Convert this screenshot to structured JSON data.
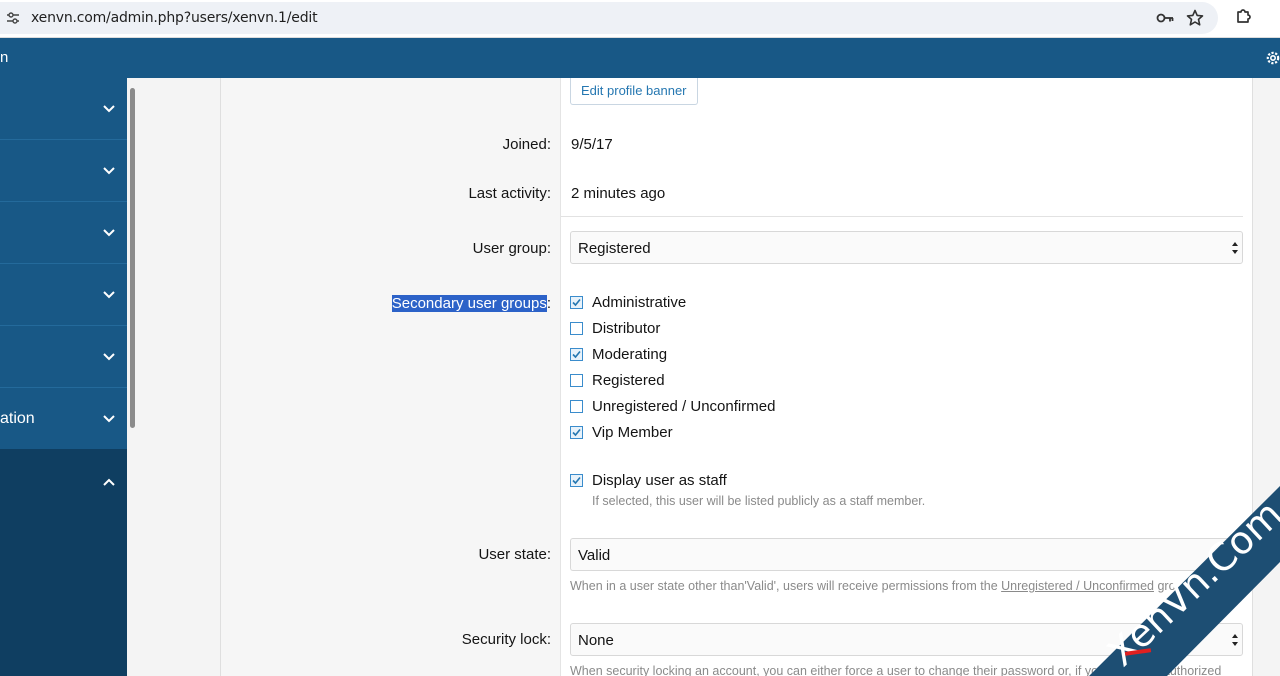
{
  "browser": {
    "url": "xenvn.com/admin.php?users/xenvn.1/edit"
  },
  "header": {
    "title_fragment": "n"
  },
  "sidebar": {
    "partial_label": "ation"
  },
  "form": {
    "edit_banner_label": "Edit profile banner",
    "joined": {
      "label": "Joined:",
      "value": "9/5/17"
    },
    "last_activity": {
      "label": "Last activity:",
      "value": "2 minutes ago"
    },
    "user_group": {
      "label": "User group:",
      "value": "Registered"
    },
    "secondary_groups": {
      "label_highlighted": "Secondary user groups",
      "label_suffix": ":",
      "options": [
        {
          "label": "Administrative",
          "checked": true
        },
        {
          "label": "Distributor",
          "checked": false
        },
        {
          "label": "Moderating",
          "checked": true
        },
        {
          "label": "Registered",
          "checked": false
        },
        {
          "label": "Unregistered / Unconfirmed",
          "checked": false
        },
        {
          "label": "Vip Member",
          "checked": true
        }
      ]
    },
    "display_staff": {
      "label": "Display user as staff",
      "checked": true,
      "hint": "If selected, this user will be listed publicly as a staff member."
    },
    "user_state": {
      "label": "User state:",
      "value": "Valid",
      "hint_prefix": "When in a user state other than'Valid', users will receive permissions from the ",
      "hint_link": "Unregistered / Unconfirmed",
      "hint_suffix": " gro"
    },
    "security_lock": {
      "label": "Security lock:",
      "value": "None",
      "hint": "When security locking an account, you can either force a user to change their password or, if yo",
      "hint_tail": "unauthorized"
    }
  },
  "watermark": {
    "text": "XenVn.Com"
  },
  "colors": {
    "admin_blue": "#185886",
    "sidebar_active": "#0f3e61",
    "selection": "#2c62c8",
    "link": "#2577b1",
    "checkbox_border": "#3a8ccc"
  }
}
